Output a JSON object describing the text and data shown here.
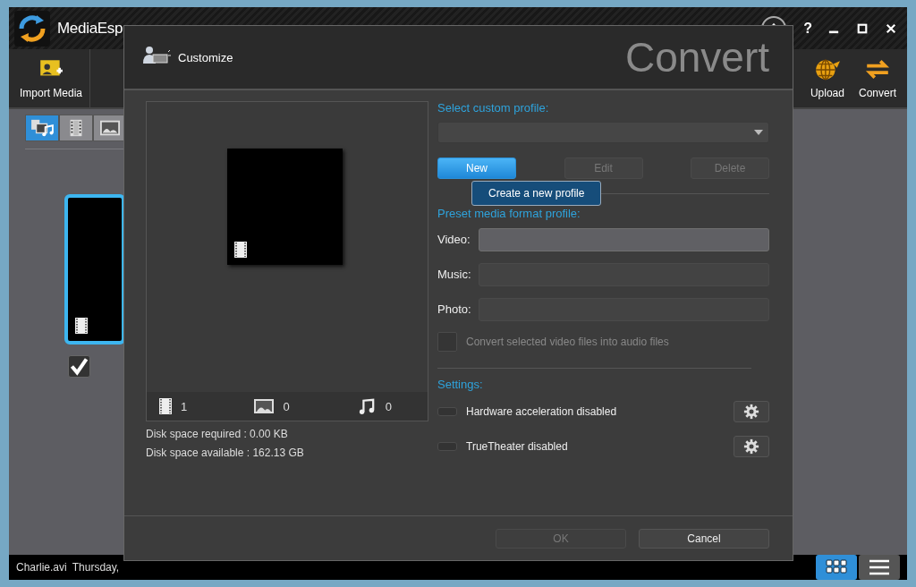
{
  "app": {
    "title": "MediaEsp",
    "help": "?"
  },
  "toolbar": [
    {
      "label": "Import Media",
      "kind": "import"
    },
    {
      "label": "Upload",
      "kind": "upload"
    },
    {
      "label": "Convert",
      "kind": "convert"
    }
  ],
  "view_tabs": [
    {
      "kind": "all",
      "selected": true
    },
    {
      "kind": "video",
      "selected": false
    },
    {
      "kind": "photo",
      "selected": false
    }
  ],
  "thumbnail": {
    "checked": true
  },
  "status_bar": {
    "file": "Charlie.avi",
    "date": "Thursday,"
  },
  "layout_toggle": [
    {
      "kind": "grid",
      "selected": true
    },
    {
      "kind": "list",
      "selected": false
    }
  ],
  "dialog": {
    "title": "Customize",
    "heading": "Convert",
    "counts": [
      {
        "kind": "video",
        "count": "1"
      },
      {
        "kind": "photo",
        "count": "0"
      },
      {
        "kind": "music",
        "count": "0"
      }
    ],
    "disk_required": "Disk space required : 0.00 KB",
    "disk_available": "Disk space available : 162.13 GB",
    "custom_profile_label": "Select custom profile:",
    "profile_buttons": [
      {
        "label": "New",
        "disabled": false
      },
      {
        "label": "Edit",
        "disabled": true
      },
      {
        "label": "Delete",
        "disabled": true
      }
    ],
    "tooltip": "Create a new profile",
    "preset_label": "Preset media format profile:",
    "presets": [
      {
        "label": "Video:",
        "disabled": false
      },
      {
        "label": "Music:",
        "disabled": true
      },
      {
        "label": "Photo:",
        "disabled": true
      }
    ],
    "audio_option": {
      "label": "Convert selected video files into audio files",
      "checked": false,
      "disabled": true
    },
    "settings_label": "Settings:",
    "settings": [
      {
        "label": "Hardware acceleration disabled",
        "on": false
      },
      {
        "label": "TrueTheater disabled",
        "on": false
      }
    ],
    "buttons": [
      {
        "label": "OK",
        "disabled": true
      },
      {
        "label": "Cancel",
        "disabled": false
      }
    ]
  }
}
